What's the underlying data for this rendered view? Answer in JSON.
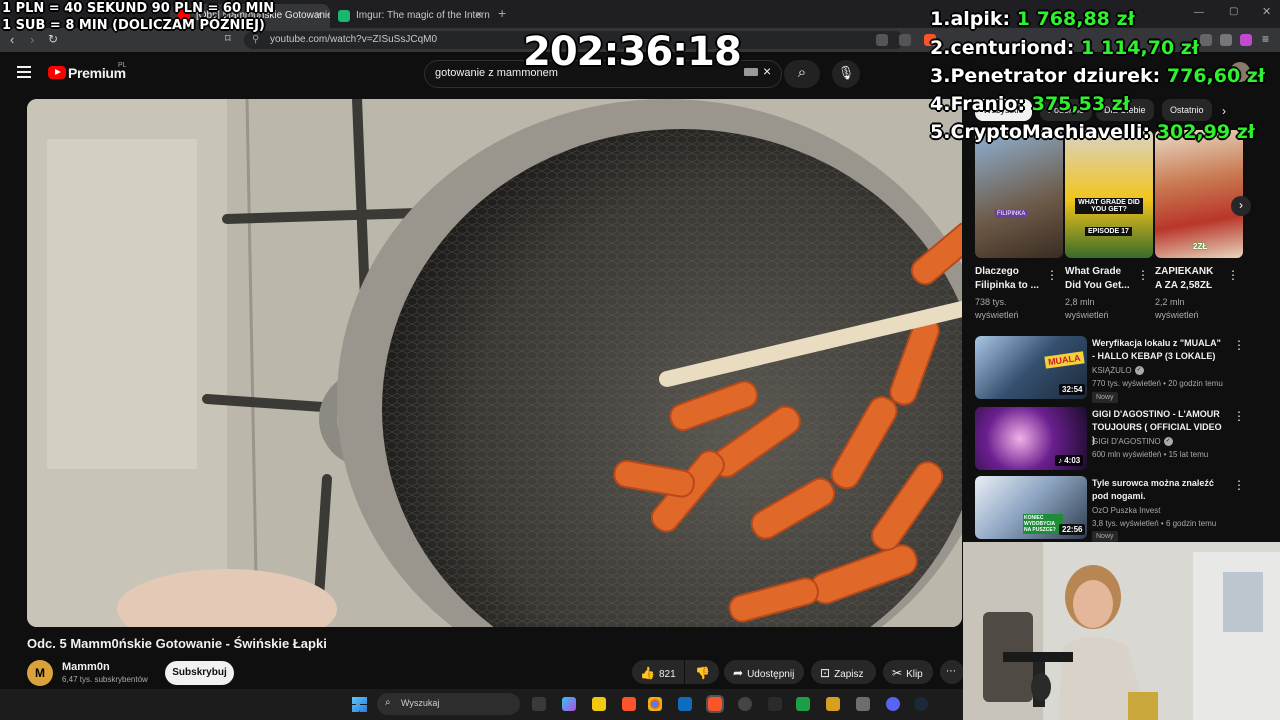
{
  "browser": {
    "tabs": [
      {
        "label": "[Obs] Mamm0ńskie Gotowanie – Świńskie Gotowanie",
        "close": "×"
      },
      {
        "label": "Imgur: The magic of the Internet",
        "close": "×"
      }
    ],
    "new_tab": "+",
    "url": "youtube.com/watch?v=ZISuSsJCqM0"
  },
  "youtube": {
    "logo_text": "Premium",
    "region": "PL",
    "search_value": "gotowanie z mammonem",
    "clear": "×",
    "video_title": "Odc. 5 Mamm0ńskie Gotowanie - Świńskie Łapki",
    "channel": {
      "avatar": "M",
      "name": "Mamm0n",
      "subs": "6,47 tys. subskrybentów",
      "subscribe": "Subskrybuj"
    },
    "actions": {
      "likes": "821",
      "share": "Udostępnij",
      "save": "Zapisz",
      "clip": "Klip",
      "more": "⋯"
    },
    "chips": [
      "Wszystkie",
      "Podobne",
      "Dla Ciebie",
      "Ostatnio"
    ],
    "shorts": [
      {
        "title": "Dlaczego Filipinka to ...",
        "views": "738 tys. wyświetleń",
        "thumb_text": "FILIPINKA"
      },
      {
        "title": "What Grade Did You Get...",
        "views": "2,8 mln wyświetleń",
        "thumb_text": "WHAT GRADE DID YOU GET?",
        "thumb_text2": "EPISODE 17"
      },
      {
        "title": "ZAPIEKANK A ZA 2,58ZŁ",
        "views": "2,2 mln wyświetleń",
        "thumb_text": "2ZŁ"
      }
    ],
    "videos": [
      {
        "title": "Weryfikacja lokalu z \"MUALA\" - HALLO KEBAP (3 LOKALE)",
        "channel": "KSIĄŻULO",
        "meta": "770 tys. wyświetleń • 20 godzin temu",
        "badge": "Nowy",
        "duration": "32:54",
        "thumb_text": "MUALA"
      },
      {
        "title": "GIGI D'AGOSTINO - L'AMOUR TOUJOURS ( OFFICIAL VIDEO )",
        "channel": "GIGI D'AGOSTINO",
        "meta": "600 mln wyświetleń • 15 lat temu",
        "badge": "",
        "duration": "4:03",
        "thumb_text": ""
      },
      {
        "title": "Tyle surowca można znaleźć pod nogami.",
        "channel": "OzO Puszka Invest",
        "meta": "3,8 tys. wyświetleń • 6 godzin temu",
        "badge": "Nowy",
        "duration": "22:56",
        "thumb_text": "KONIEC WYDOBYCIA NA PUSZCE?"
      }
    ]
  },
  "overlay": {
    "rates": [
      "1 PLN =  40 SEKUND 90 PLN = 60 MIN",
      "1 SUB = 8 MIN (DOLICZAM PÓŹNIEJ)"
    ],
    "timer": "202:36:18",
    "leaderboard": [
      {
        "name": "1.alpik:",
        "amount": "1 768,88 zł"
      },
      {
        "name": "2.centuriond:",
        "amount": "1 114,70 zł"
      },
      {
        "name": "3.Penetrator dziurek:",
        "amount": "776,60 zł"
      },
      {
        "name": "4.Franio:",
        "amount": "375,53 zł"
      },
      {
        "name": "5.CryptoMachiavelli:",
        "amount": "302,99 zł"
      }
    ]
  },
  "taskbar": {
    "search": "Wyszukaj"
  },
  "colors": {
    "accent": "#ff0000",
    "leaderboard_amount": "#2df22d",
    "bg": "#0f0f0f"
  }
}
